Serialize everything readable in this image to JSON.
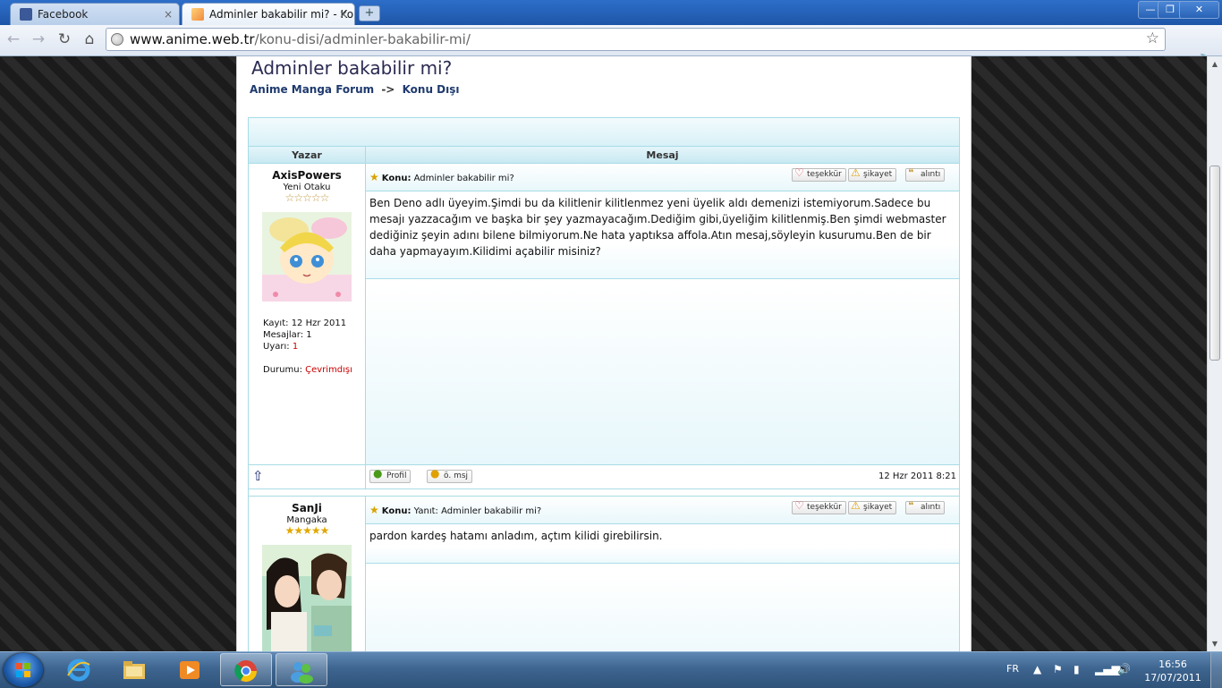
{
  "browser": {
    "tabs": [
      {
        "title": "Facebook",
        "active": false
      },
      {
        "title": "Adminler bakabilir mi? - Ko",
        "active": true
      }
    ],
    "tab_close_glyph": "×",
    "new_tab_glyph": "+",
    "window_controls": {
      "minimize": "—",
      "restore": "❐",
      "close": "✕"
    },
    "nav": {
      "back": "←",
      "forward": "→",
      "reload": "↻",
      "home": "⌂"
    },
    "url_host": "www.anime.web.tr",
    "url_path": "/konu-disi/adminler-bakabilir-mi/",
    "bookmark_star": "☆",
    "wrench": "🔧"
  },
  "page": {
    "title": "Adminler bakabilir mi?",
    "breadcrumb": {
      "forum": "Anime Manga Forum",
      "separator": "->",
      "section": "Konu Dışı"
    },
    "table_headers": {
      "author": "Yazar",
      "message": "Mesaj"
    },
    "actions": {
      "thanks": "teşekkür",
      "report": "şikayet",
      "quote": "alıntı"
    },
    "footer_buttons": {
      "profile": "Profil",
      "pm": "ö. msj"
    },
    "subject_label": "Konu:",
    "posts": [
      {
        "author": "AxisPowers",
        "rank": "Yeni Otaku",
        "stars": "☆☆☆☆☆",
        "registered_label": "Kayıt:",
        "registered": "12 Hzr 2011",
        "messages_label": "Mesajlar:",
        "messages": "1",
        "warnings_label": "Uyarı:",
        "warnings": "1",
        "status_label": "Durumu:",
        "status": "Çevrimdışı",
        "subject": "Adminler bakabilir mi?",
        "body": "Ben Deno adlı üyeyim.Şimdi bu da kilitlenir kilitlenmez yeni üyelik aldı demenizi istemiyorum.Sadece bu mesajı yazzacağım ve başka bir şey yazmayacağım.Dediğim gibi,üyeliğim kilitlenmiş.Ben şimdi webmaster dediğiniz şeyin adını bilene bilmiyorum.Ne hata yaptıksa affola.Atın mesaj,söyleyin kusurumu.Ben de bir daha yapmayayım.Kilidimi açabilir misiniz?",
        "date": "12 Hzr 2011 8:21"
      },
      {
        "author": "SanJi",
        "rank": "Mangaka",
        "stars": "★★★★★",
        "subject": "Yanıt: Adminler bakabilir mi?",
        "body": "pardon kardeş hatamı anladım, açtım kilidi girebilirsin."
      }
    ]
  },
  "taskbar": {
    "language": "FR",
    "time": "16:56",
    "date": "17/07/2011"
  },
  "colors": {
    "tab_bar": "#1e56a8",
    "header_border": "#a8dce6",
    "title_text": "#2a2a52",
    "warning_red": "#cc0000"
  }
}
